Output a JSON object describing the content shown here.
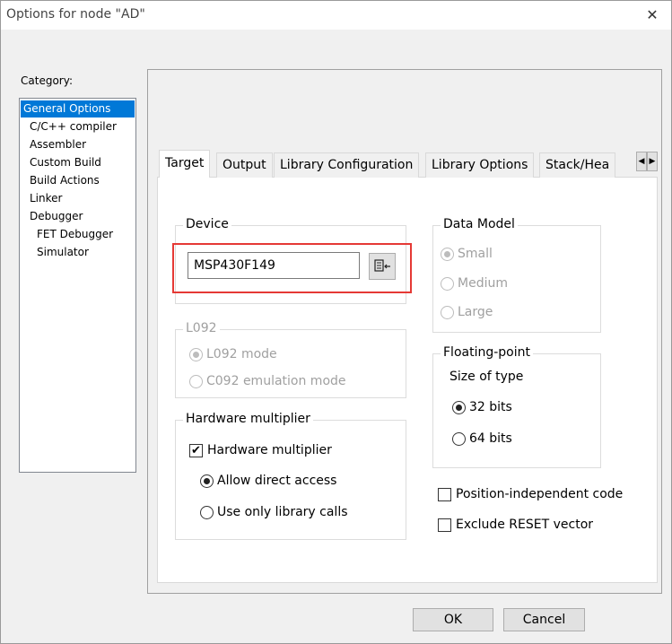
{
  "window": {
    "title": "Options for node \"AD\"",
    "close_glyph": "✕"
  },
  "category": {
    "label": "Category:",
    "items": [
      {
        "label": "General Options",
        "selected": true,
        "indent": 0
      },
      {
        "label": "C/C++ compiler",
        "indent": 1
      },
      {
        "label": "Assembler",
        "indent": 1
      },
      {
        "label": "Custom Build",
        "indent": 1
      },
      {
        "label": "Build Actions",
        "indent": 1
      },
      {
        "label": "Linker",
        "indent": 1
      },
      {
        "label": "Debugger",
        "indent": 1
      },
      {
        "label": "FET Debugger",
        "indent": 2
      },
      {
        "label": "Simulator",
        "indent": 2
      }
    ]
  },
  "tabs": [
    {
      "label": "Target",
      "active": true
    },
    {
      "label": "Output"
    },
    {
      "label": "Library Configuration"
    },
    {
      "label": "Library Options"
    },
    {
      "label": "Stack/Hea"
    }
  ],
  "tab_arrows": {
    "left": "◀",
    "right": "▶"
  },
  "device": {
    "group_title": "Device",
    "value": "MSP430F149"
  },
  "l092": {
    "group_title": "L092",
    "options": [
      {
        "label": "L092 mode",
        "checked": true
      },
      {
        "label": "C092 emulation mode",
        "checked": false
      }
    ]
  },
  "hw_mult": {
    "group_title": "Hardware multiplier",
    "checkbox_label": "Hardware multiplier",
    "checkbox_checked": true,
    "check_glyph": "✔",
    "options": [
      {
        "label": "Allow direct access",
        "checked": true
      },
      {
        "label": "Use only library calls",
        "checked": false
      }
    ]
  },
  "data_model": {
    "group_title": "Data Model",
    "options": [
      {
        "label": "Small",
        "checked": true
      },
      {
        "label": "Medium",
        "checked": false
      },
      {
        "label": "Large",
        "checked": false
      }
    ]
  },
  "floating_point": {
    "group_title": "Floating-point",
    "size_label": "Size of type",
    "options": [
      {
        "label": "32 bits",
        "checked": true
      },
      {
        "label": "64 bits",
        "checked": false
      }
    ]
  },
  "extra": {
    "position_independent": "Position-independent code",
    "exclude_reset": "Exclude RESET vector"
  },
  "buttons": {
    "ok": "OK",
    "cancel": "Cancel"
  },
  "colors": {
    "selection": "#0078d7",
    "highlight_box": "#e53935"
  }
}
